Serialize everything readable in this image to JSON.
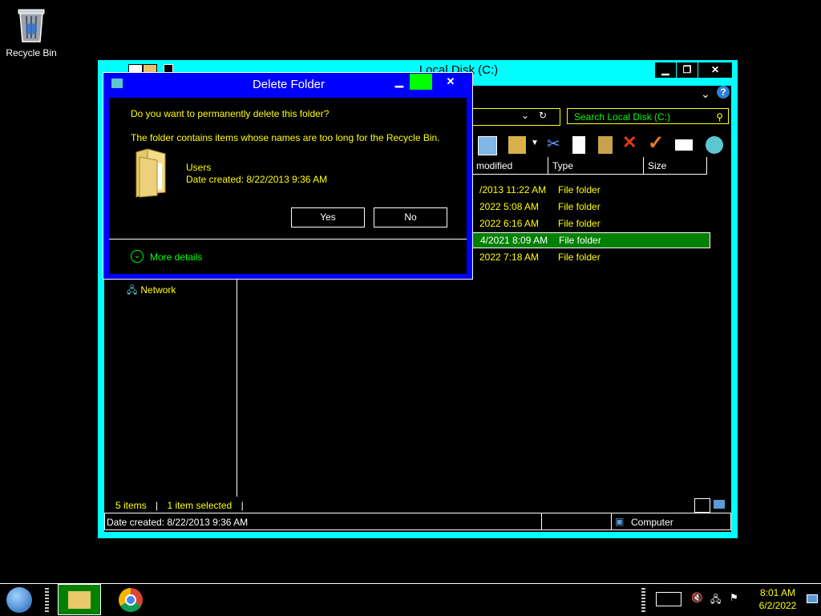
{
  "desktop": {
    "recycle_bin_label": "Recycle Bin"
  },
  "explorer": {
    "title": "Local Disk (C:)",
    "minimize": "▁",
    "maximize": "❐",
    "close": "✕",
    "search_placeholder": "Search Local Disk (C:)",
    "columns": [
      "modified",
      "Type",
      "Size"
    ],
    "rows": [
      {
        "date": "/2013 11:22 AM",
        "type": "File folder",
        "selected": false
      },
      {
        "date": "2022 5:08 AM",
        "type": "File folder",
        "selected": false
      },
      {
        "date": "2022 6:16 AM",
        "type": "File folder",
        "selected": false
      },
      {
        "date": "4/2021 8:09 AM",
        "type": "File folder",
        "selected": true
      },
      {
        "date": "2022 7:18 AM",
        "type": "File folder",
        "selected": false
      }
    ],
    "nav_network": "Network",
    "items_count": "5 items",
    "items_selected": "1 item selected",
    "statusbar_date": "Date created: 8/22/2013 9:36 AM",
    "statusbar_location": "Computer"
  },
  "dialog": {
    "title": "Delete Folder",
    "question": "Do you want to permanently delete this folder?",
    "message": "The folder contains items whose names are too long for the Recycle Bin.",
    "item_name": "Users",
    "item_date": "Date created: 8/22/2013 9:36 AM",
    "yes": "Yes",
    "no": "No",
    "more_details": "More details"
  },
  "taskbar": {
    "time": "8:01 AM",
    "date": "6/2/2022"
  },
  "colors": {
    "accent": "#00ffff",
    "dialog": "#0000ff",
    "text_yellow": "#ffff00",
    "text_green": "#00ff00",
    "selection": "#008000"
  }
}
